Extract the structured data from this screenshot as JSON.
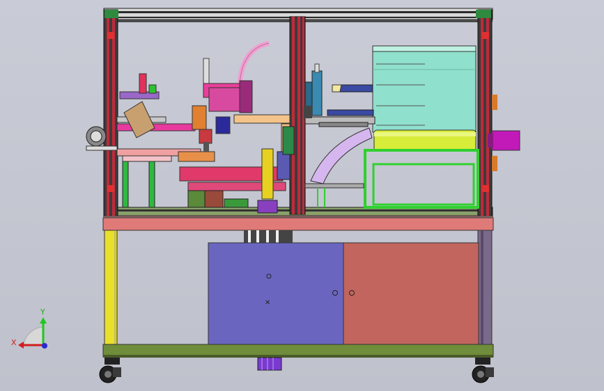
{
  "view": {
    "background": "#c5c7d2"
  },
  "triad": {
    "x_label": "X",
    "y_label": "Y",
    "x_color": "#d21e1e",
    "y_color": "#1ec81e",
    "z_color": "#2a2ad2"
  },
  "colors": {
    "frame_profile": "#3a3a3a",
    "frame_accent_red": "#c02a3a",
    "table_top": "#e07a78",
    "table_green": "#6f8d3a",
    "cabinet_left": "#6a66c0",
    "cabinet_right": "#c2655e",
    "left_leg": "#e8e02a",
    "hopper": "#8fe0cc",
    "yellow_drum": "#d8ec3a",
    "magenta_cylinder": "#c21ab8",
    "green_base": "#3ad83a"
  }
}
